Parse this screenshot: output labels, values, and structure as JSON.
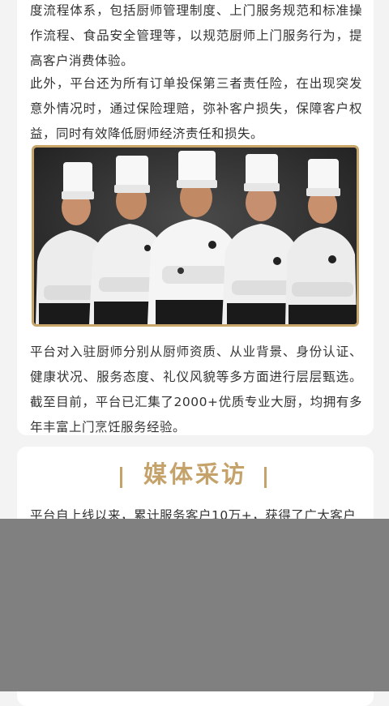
{
  "intro": {
    "paragraph_1": "度流程体系，包括厨师管理制度、上门服务规范和标准操作流程、食品安全管理等，以规范厨师上门服务行为，提高客户消费体验。",
    "paragraph_2": "此外，平台还为所有订单投保第三者责任险，在出现突发意外情况时，通过保险理赔，弥补客户损失，保障客户权益，同时有效降低厨师经济责任和损失。",
    "paragraph_3": "平台对入驻厨师分别从厨师资质、从业背景、身份认证、健康状况、服务态度、礼仪风貌等多方面进行层层甄选。截至目前，平台已汇集了2000+优质专业大厨，均拥有多年丰富上门烹饪服务经验。"
  },
  "media": {
    "title": "媒体采访",
    "paragraph_1_partial": "平台自上线以来，累计服务客户10万+，获得了广大客户"
  },
  "colors": {
    "accent_gold": "#c4a26a",
    "body_text": "#333333",
    "overlay_gray": "#808080",
    "page_bg": "#f3f3f3"
  }
}
